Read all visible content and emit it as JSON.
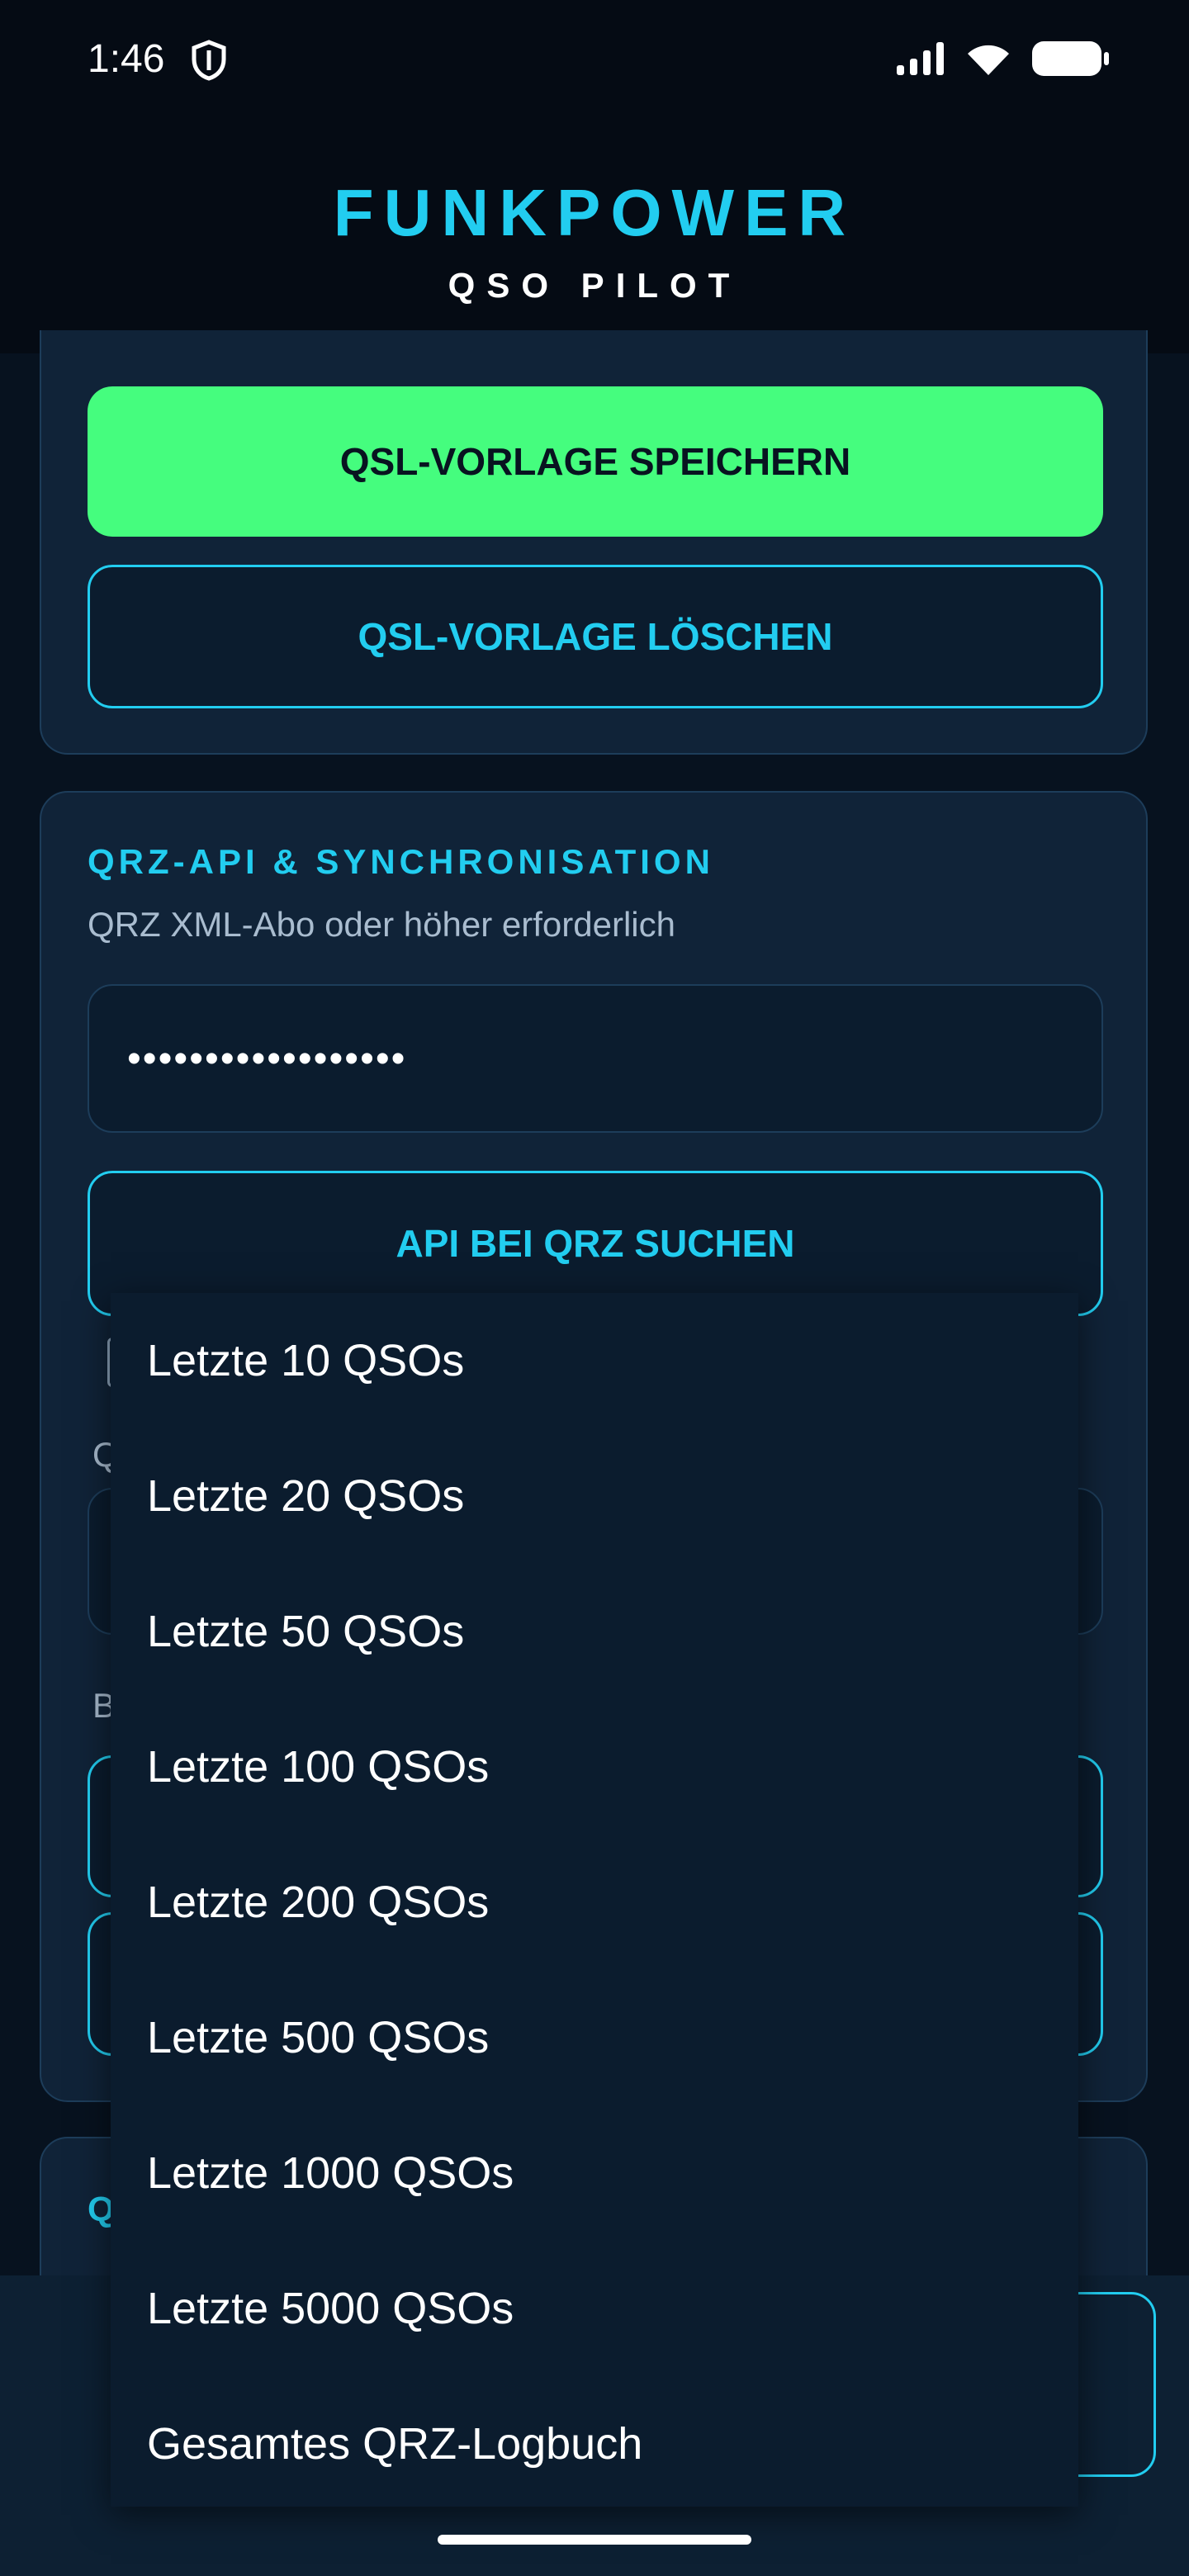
{
  "status_bar": {
    "time": "1:46"
  },
  "header": {
    "title": "FUNKPOWER",
    "subtitle": "QSO PILOT"
  },
  "qsl_card": {
    "save_label": "QSL-VORLAGE SPEICHERN",
    "delete_label": "QSL-VORLAGE LÖSCHEN"
  },
  "qrz_card": {
    "title": "QRZ-API & SYNCHRONISATION",
    "subtitle": "QRZ XML-Abo oder höher erforderlich",
    "api_key_value": "••••••••••••••••••",
    "search_api_label": "API BEI QRZ SUCHEN",
    "fragment_q": "Q",
    "fragment_b": "B"
  },
  "next_card": {
    "fragment_q": "Q"
  },
  "dropdown": {
    "options": [
      "Letzte 10 QSOs",
      "Letzte 20 QSOs",
      "Letzte 50 QSOs",
      "Letzte 100 QSOs",
      "Letzte 200 QSOs",
      "Letzte 500 QSOs",
      "Letzte 1000 QSOs",
      "Letzte 5000 QSOs",
      "Gesamtes QRZ-Logbuch"
    ]
  },
  "colors": {
    "accent": "#22cdf0",
    "primary_button": "#45fd7e",
    "card_bg": "#102338",
    "background": "#07121f"
  }
}
